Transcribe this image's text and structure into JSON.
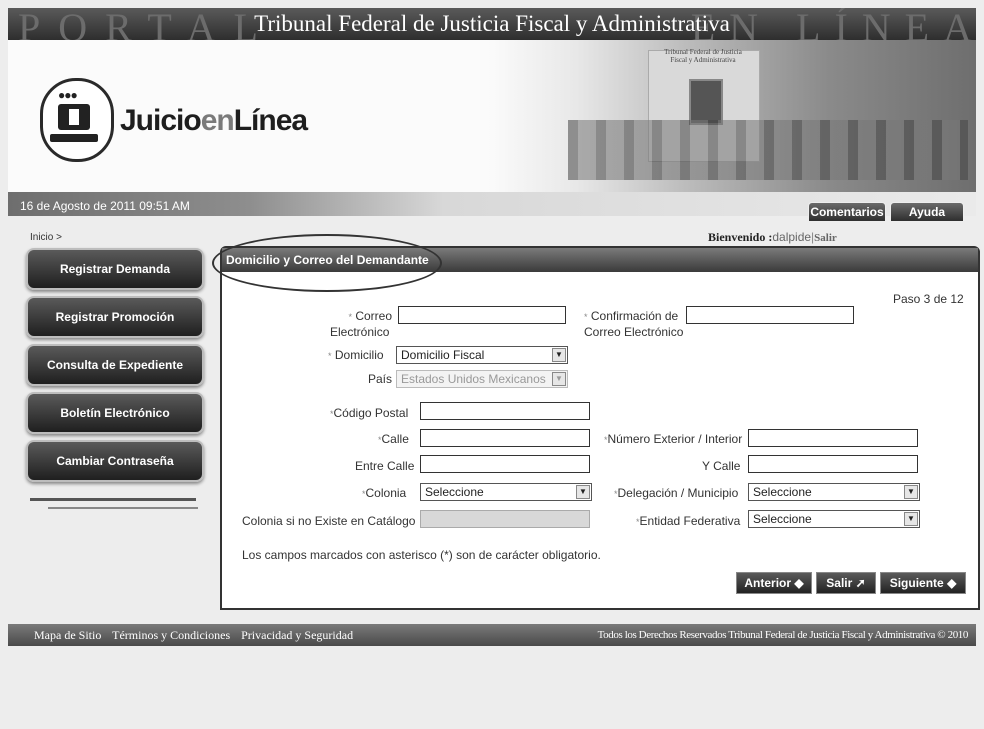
{
  "header": {
    "title": "Tribunal Federal de Justicia Fiscal y Administrativa",
    "ghost_left": "PORTAL",
    "ghost_right": "EN LÍNEA",
    "logo_text_1": "Juicio",
    "logo_text_2": "en",
    "logo_text_3": "Línea",
    "plate_text": "Tribunal Federal de Justicia Fiscal y Administrativa"
  },
  "datebar": {
    "date": "16 de Agosto de 2011 09:51 AM",
    "comments_label": "Comentarios",
    "help_label": "Ayuda"
  },
  "breadcrumb": "Inicio >",
  "welcome": {
    "label": "Bienvenido :",
    "user": "dalpide",
    "separator": "|",
    "logout": "Salir"
  },
  "sidebar": {
    "items": [
      {
        "label": "Registrar Demanda"
      },
      {
        "label": "Registrar Promoción"
      },
      {
        "label": "Consulta de Expediente"
      },
      {
        "label": "Boletín Electrónico"
      },
      {
        "label": "Cambiar Contraseña"
      }
    ]
  },
  "panel": {
    "title": "Domicilio y Correo del Demandante",
    "step": "Paso 3 de 12"
  },
  "form": {
    "required_mark": "*",
    "email_label_1": "Correo",
    "email_label_2": "Electrónico",
    "email_value": "",
    "email_confirm_label_1": "Confirmación de",
    "email_confirm_label_2": "Correo Electrónico",
    "email_confirm_value": "",
    "domicilio_label": "Domicilio",
    "domicilio_value": "Domicilio Fiscal",
    "pais_label": "País",
    "pais_value": "Estados Unidos Mexicanos",
    "cp_label": "Código Postal",
    "calle_label": "Calle",
    "numero_label": "Número Exterior / Interior",
    "entre_calle_label": "Entre Calle",
    "y_calle_label": "Y Calle",
    "colonia_label": "Colonia",
    "colonia_value": "Seleccione",
    "delegacion_label": "Delegación / Municipio",
    "delegacion_value": "Seleccione",
    "colonia_otra_label": "Colonia si no Existe en Catálogo",
    "entidad_label": "Entidad Federativa",
    "entidad_value": "Seleccione",
    "note": "Los campos marcados con asterisco (*) son de carácter obligatorio."
  },
  "actions": {
    "previous": "Anterior",
    "exit": "Salir",
    "next": "Siguiente"
  },
  "footer": {
    "links": [
      "Mapa de Sitio",
      "Términos y Condiciones",
      "Privacidad y Seguridad"
    ],
    "copyright": "Todos los Derechos Reservados Tribunal Federal de Justicia Fiscal y Administrativa © 2010"
  }
}
